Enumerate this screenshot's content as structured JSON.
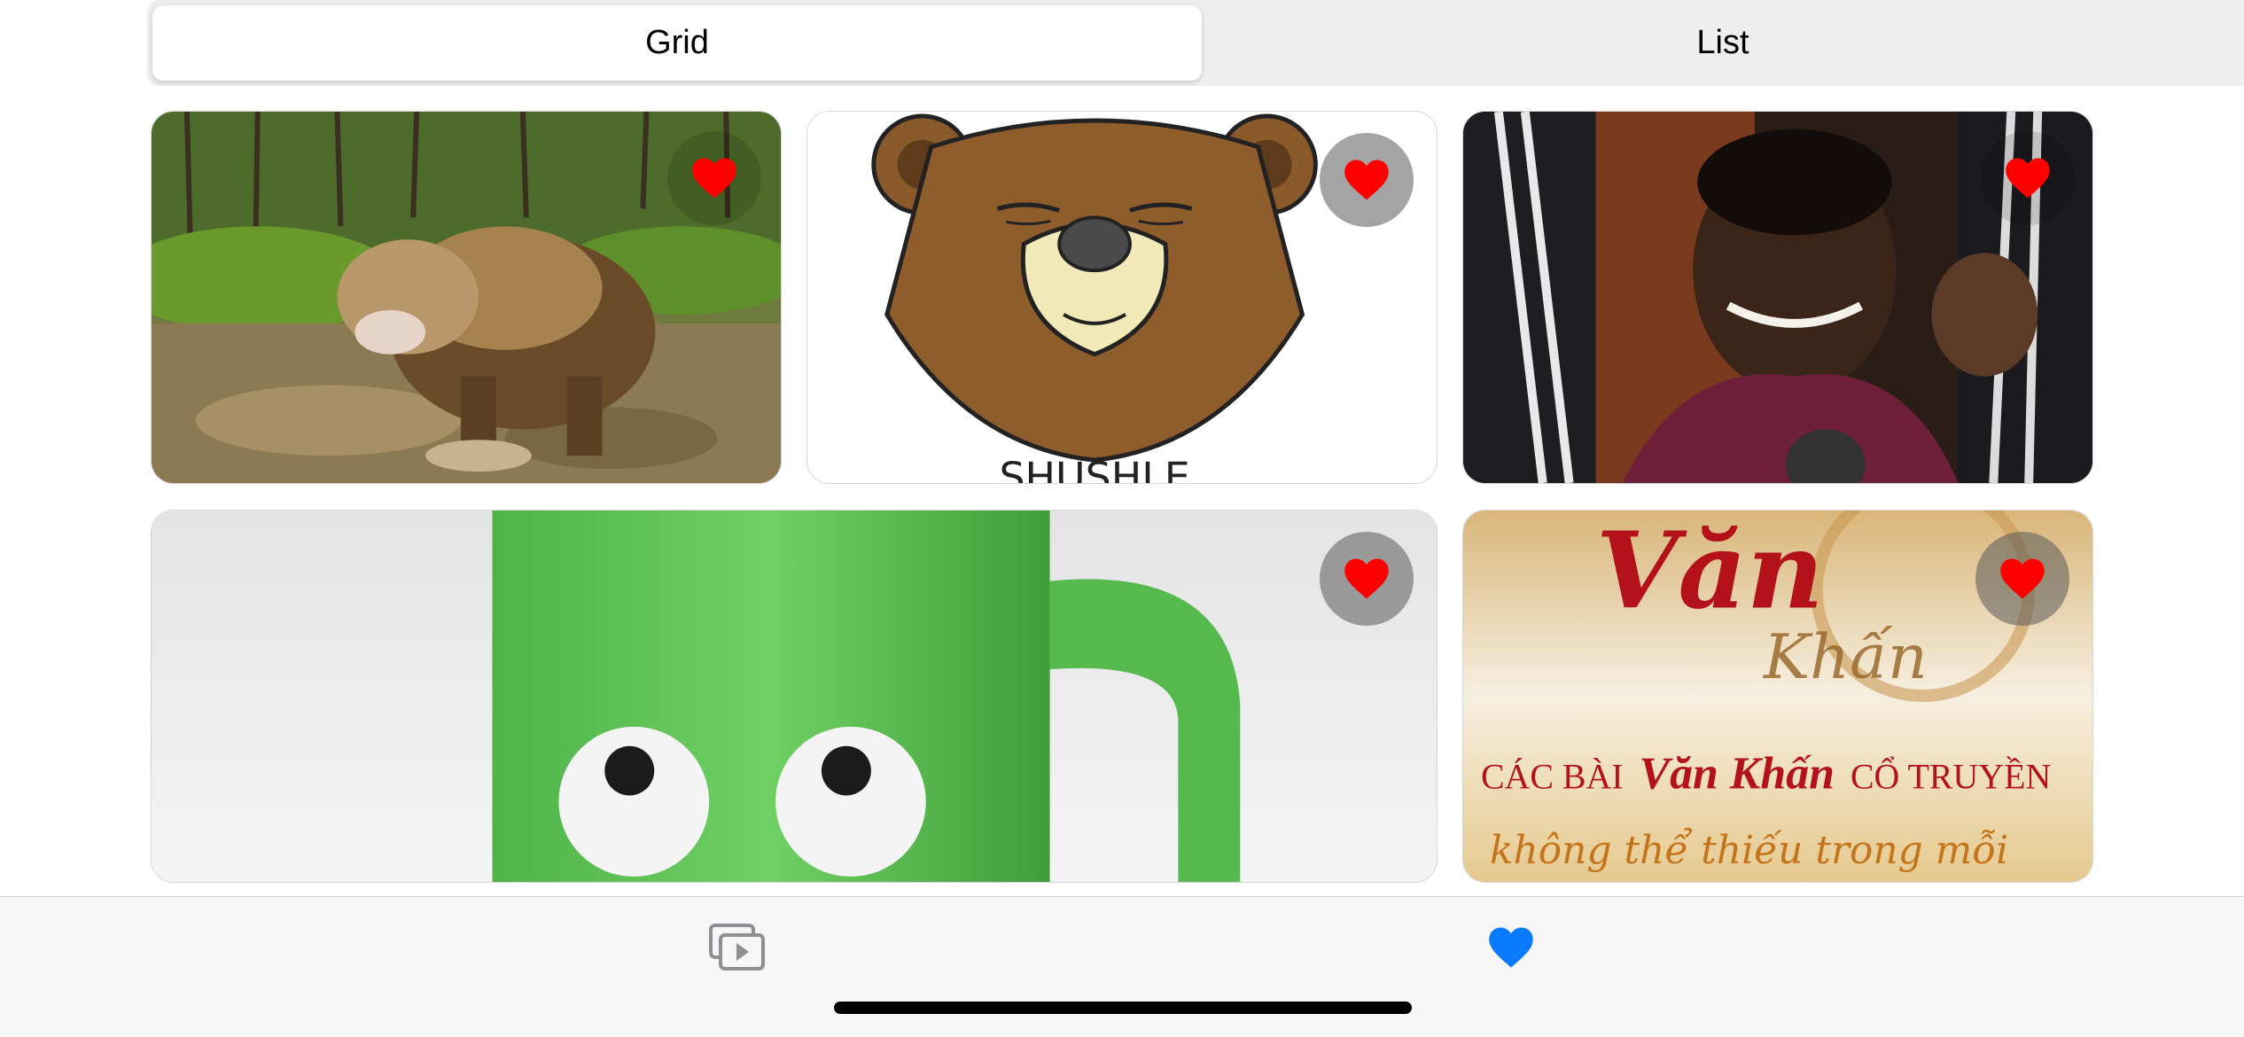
{
  "segments": {
    "grid_label": "Grid",
    "list_label": "List",
    "selected": "Grid"
  },
  "grid": {
    "items": [
      {
        "subject": "brown bear standing in a forest stream",
        "favorited": true
      },
      {
        "subject": "cartoon bear face",
        "favorited": true
      },
      {
        "subject": "smiling man in maroon scarf",
        "favorited": true
      },
      {
        "subject": "green mug with googly eyes",
        "favorited": true
      },
      {
        "subject": "Văn Khấn banner",
        "favorited": true,
        "visible_text": [
          "Văn",
          "Khấn",
          "CÁC BÀI",
          "Văn Khấn",
          "CỔ TRUYỀN",
          "không thể thiếu trong mỗi"
        ]
      }
    ]
  },
  "tabbar": {
    "tabs": [
      {
        "icon": "play-gallery-icon",
        "selected": false
      },
      {
        "icon": "heart-icon",
        "selected": true
      }
    ]
  },
  "colors": {
    "heart": "#ff0000",
    "tab_active": "#0a7aff",
    "tab_inactive": "#8e8e93",
    "segment_bg": "#eeeeef"
  }
}
